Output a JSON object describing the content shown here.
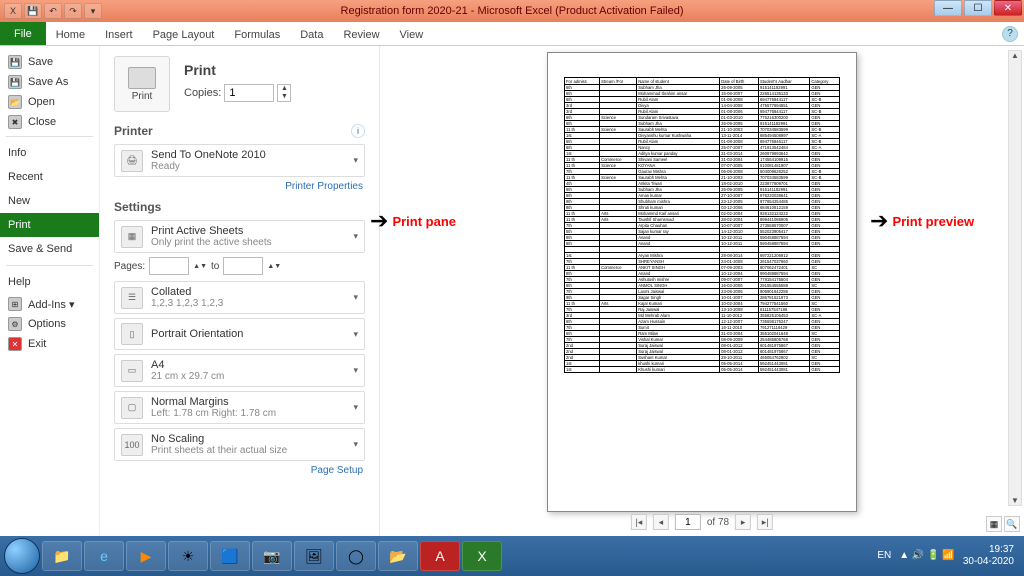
{
  "title": "Registration form 2020-21  -  Microsoft Excel (Product Activation Failed)",
  "ribbon": {
    "file": "File",
    "tabs": [
      "Home",
      "Insert",
      "Page Layout",
      "Formulas",
      "Data",
      "Review",
      "View"
    ]
  },
  "nav": {
    "save": "Save",
    "saveas": "Save As",
    "open": "Open",
    "close": "Close",
    "info": "Info",
    "recent": "Recent",
    "new": "New",
    "print": "Print",
    "savesend": "Save & Send",
    "help": "Help",
    "addins": "Add-Ins ▾",
    "options": "Options",
    "exit": "Exit"
  },
  "print": {
    "heading": "Print",
    "btn": "Print",
    "copies_label": "Copies:",
    "copies": "1",
    "printer_h": "Printer",
    "printer_name": "Send To OneNote 2010",
    "printer_status": "Ready",
    "printer_props": "Printer Properties",
    "settings_h": "Settings",
    "s1": {
      "t": "Print Active Sheets",
      "s": "Only print the active sheets"
    },
    "pages": "Pages:",
    "to": "to",
    "s2": {
      "t": "Collated",
      "s": "1,2,3   1,2,3   1,2,3"
    },
    "s3": {
      "t": "Portrait Orientation",
      "s": ""
    },
    "s4": {
      "t": "A4",
      "s": "21 cm x 29.7 cm"
    },
    "s5": {
      "t": "Normal Margins",
      "s": "Left: 1.78 cm   Right: 1.78 cm"
    },
    "s6": {
      "t": "No Scaling",
      "s": "Print sheets at their actual size"
    },
    "pagesetup": "Page Setup"
  },
  "annot": {
    "pane": "Print pane",
    "preview": "Print preview"
  },
  "pager": {
    "page": "1",
    "of": "of 78"
  },
  "clock": {
    "time": "19:37",
    "date": "30-04-2020"
  },
  "tray": {
    "lang": "EN"
  },
  "headers": [
    "For admiss",
    "Stream /For",
    "Name of student",
    "Date of Birth",
    "Student's Aadhar",
    "Category"
  ],
  "rows": [
    [
      "6th",
      "",
      "Subham Jha",
      "26-09-2005",
      "915141182991",
      "GEN"
    ],
    [
      "6th",
      "",
      "Mohammad Ibrahim ansar",
      "15-08-2007",
      "226514135133",
      "GEN"
    ],
    [
      "6th",
      "",
      "Rubil Alam",
      "01-08-2008",
      "694776844117",
      "SC-B"
    ],
    [
      "3rd",
      "",
      "Divya",
      "14-04-2008",
      "475577694551",
      "GEN"
    ],
    [
      "3rd",
      "",
      "Rubil Alam",
      "01-08-2006",
      "694776844117",
      "SC-B"
    ],
    [
      "6th",
      "Science",
      "Sundaram Srivastava",
      "01-03-2010",
      "775216300200",
      "GEN"
    ],
    [
      "6th",
      "",
      "Subham Jha",
      "26-09-2005",
      "915141182991",
      "GEN"
    ],
    [
      "11 th",
      "Science",
      "Saurabh Mehta",
      "21-10-2003",
      "707034583599",
      "SC-B"
    ],
    [
      "1st",
      "",
      "Divyanshu kumar Kushwaha",
      "13-11-2014",
      "685494508997",
      "SC-A"
    ],
    [
      "6th",
      "",
      "Rubil Alam",
      "01-08-2008",
      "694776846117",
      "SC-B"
    ],
    [
      "6th",
      "",
      "Nancy",
      "25-07-2007",
      "471913542484",
      "SC-A"
    ],
    [
      "1st",
      "",
      "Aditya kumar panday",
      "31-03-2014",
      "260979893642",
      "GEN"
    ],
    [
      "11 th",
      "Commerce",
      "Shivani Sameel",
      "31-03-2004",
      "174554109915",
      "GEN"
    ],
    [
      "11 th",
      "Science",
      "KOYANA",
      "07-07-2005",
      "510081481907",
      "GEN"
    ],
    [
      "7th",
      "",
      "Gaurav Mishra",
      "06-08-2008",
      "504009626252",
      "SC-B"
    ],
    [
      "11 th",
      "Science",
      "Saurabh Mehta",
      "21-10-2003",
      "707034583599",
      "SC-B"
    ],
    [
      "4th",
      "",
      "Ankita Tiwari",
      "18-02-2010",
      "223877809701",
      "GEN"
    ],
    [
      "6th",
      "",
      "Subham Jha",
      "26-09-2005",
      "915141182991",
      "GEN"
    ],
    [
      "9th",
      "",
      "Aman kumar",
      "27-10-2007",
      "976220038641",
      "GEN"
    ],
    [
      "9th",
      "",
      "Shubham mishra",
      "23-12-2005",
      "977654254485",
      "GEN"
    ],
    [
      "8th",
      "",
      "Shruti kumari",
      "03-12-2006",
      "684610812159",
      "GEN"
    ],
    [
      "11 th",
      "Arts",
      "Mohammd Kaif ansari",
      "02-02-2004",
      "926132124222",
      "GEN"
    ],
    [
      "11 th",
      "Arts",
      "Taushif Shamsmad",
      "28-02-2004",
      "899441086905",
      "GEN"
    ],
    [
      "7th",
      "",
      "Arpita Chauhan",
      "10-07-2007",
      "273558570007",
      "GEN"
    ],
    [
      "5th",
      "",
      "Sajan kumar ray",
      "14-12-2010",
      "552023905417",
      "GEN"
    ],
    [
      "8th",
      "",
      "Anand",
      "10-12-2011",
      "590458887594",
      "GEN"
    ],
    [
      "8th",
      "",
      "Anand",
      "10-12-2011",
      "590458887594",
      "GEN"
    ],
    [
      "",
      "",
      "",
      "",
      "",
      ""
    ],
    [
      "1st",
      "",
      "Aryan Mishra",
      "28-08-2014",
      "697221206912",
      "GEN"
    ],
    [
      "7th",
      "",
      "SHREYANSH",
      "24-01-2008",
      "261547037660",
      "GEN"
    ],
    [
      "11 th",
      "Commerce",
      "ANKIT SINGH",
      "07-09-2003",
      "807062472401",
      "SC"
    ],
    [
      "8th",
      "",
      "Anand",
      "10-12-2004",
      "990488887594",
      "GEN"
    ],
    [
      "7th",
      "",
      "Ashutosh mishre",
      "09-07-2007",
      "778154175504",
      "GEN"
    ],
    [
      "8th",
      "",
      "ANMOL SINGH",
      "16-03-2006",
      "291554555588",
      "SC"
    ],
    [
      "7th",
      "",
      "Laxmi Jaiswal",
      "23-08-2006",
      "906901842286",
      "GEN"
    ],
    [
      "9th",
      "",
      "Sagar Singh",
      "10-01-2007",
      "286781521973",
      "GEN"
    ],
    [
      "11 th",
      "Arts",
      "Kajal Kumari",
      "10-02-2004",
      "794277541560",
      "SC"
    ],
    [
      "7th",
      "",
      "Raj Jaiswal",
      "13-10-2008",
      "611157547186",
      "GEN"
    ],
    [
      "3rd",
      "",
      "Md Mehrab Alam",
      "11-10-2012",
      "355825106453",
      "SC-A"
    ],
    [
      "6th",
      "",
      "Azam Hussain",
      "12-12-2007",
      "735598175247",
      "GEN"
    ],
    [
      "7th",
      "",
      "Sumit",
      "16-11-2010",
      "791271116429",
      "GEN"
    ],
    [
      "6th",
      "",
      "Ram Milan",
      "31-03-2004",
      "355102041648",
      "SC"
    ],
    [
      "7th",
      "",
      "Vishal Kumar",
      "08-09-2009",
      "254485805768",
      "GEN"
    ],
    [
      "2nd",
      "",
      "Suraj Jaiswal",
      "08-01-2012",
      "601481975867",
      "GEN"
    ],
    [
      "2nd",
      "",
      "Suraj Jaiswal",
      "08-01-2012",
      "601481975867",
      "GEN"
    ],
    [
      "2nd",
      "",
      "Sushant  Kumar",
      "28-10-2011",
      "465054762902",
      "SC"
    ],
    [
      "1st",
      "",
      "khushi kumari",
      "05-05-2014",
      "592451443081",
      "GEN"
    ],
    [
      "1st",
      "",
      "Khushi kumari",
      "05-05-2014",
      "592451443081",
      "GEN"
    ]
  ],
  "chart_data": null
}
